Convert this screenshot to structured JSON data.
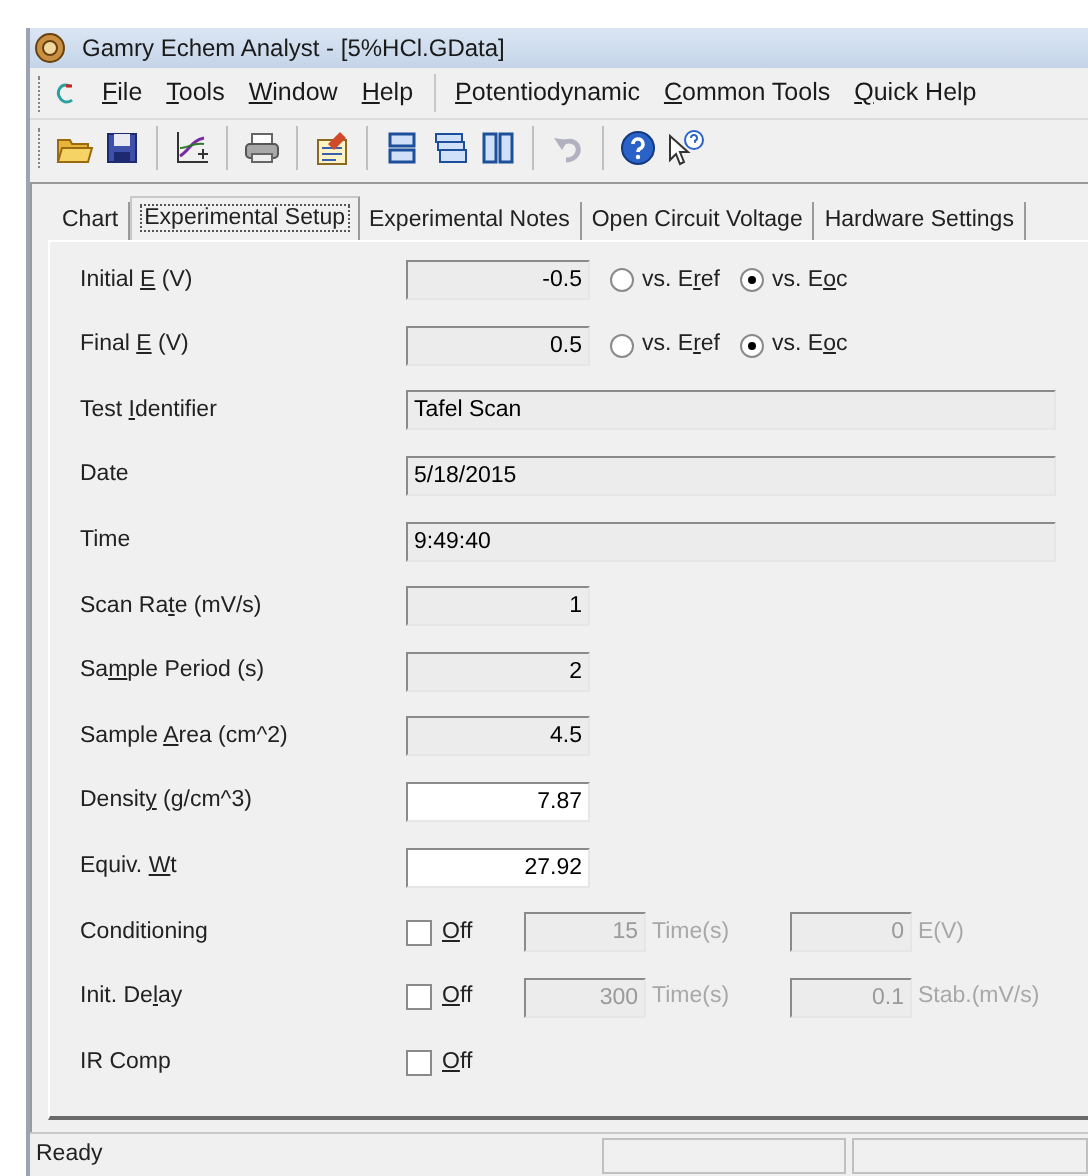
{
  "window": {
    "title": "Gamry Echem Analyst - [5%HCl.GData]"
  },
  "menu_groups": [
    [
      {
        "label": {
          "key": "F",
          "after": "ile"
        }
      },
      {
        "label": {
          "key": "T",
          "after": "ools"
        }
      },
      {
        "label": {
          "key": "W",
          "after": "indow"
        }
      },
      {
        "label": {
          "key": "H",
          "after": "elp"
        }
      }
    ],
    [
      {
        "label": {
          "key": "P",
          "after": "otentiodynamic"
        }
      },
      {
        "label": {
          "key": "C",
          "after": "ommon Tools"
        }
      },
      {
        "label": {
          "key": "Q",
          "after": "uick Help"
        }
      }
    ]
  ],
  "toolbar": [
    {
      "kind": "open",
      "disabled": false
    },
    {
      "kind": "save",
      "disabled": false
    },
    {
      "kind": "separator"
    },
    {
      "kind": "chart",
      "disabled": false
    },
    {
      "kind": "separator"
    },
    {
      "kind": "print",
      "disabled": false
    },
    {
      "kind": "separator"
    },
    {
      "kind": "notes",
      "disabled": false
    },
    {
      "kind": "separator"
    },
    {
      "kind": "rows",
      "disabled": false
    },
    {
      "kind": "stack",
      "disabled": false
    },
    {
      "kind": "columns",
      "disabled": false
    },
    {
      "kind": "separator"
    },
    {
      "kind": "undo",
      "disabled": true
    },
    {
      "kind": "separator"
    },
    {
      "kind": "help",
      "disabled": false
    },
    {
      "kind": "pointer_help",
      "disabled": false
    }
  ],
  "tabs": [
    {
      "label": "Chart",
      "selected": false
    },
    {
      "label": "Experimental Setup",
      "selected": true
    },
    {
      "label": "Experimental Notes",
      "selected": false
    },
    {
      "label": "Open Circuit Voltage",
      "selected": false
    },
    {
      "label": "Hardware Settings",
      "selected": false
    }
  ],
  "rows": [
    {
      "kind": "potential",
      "label": {
        "before": "Initial ",
        "key": "E",
        "after": " (V)"
      },
      "value": "-0.5",
      "editable": false,
      "options": [
        {
          "label": {
            "before": "vs. E",
            "key": "r",
            "after": "ef"
          },
          "selected": false
        },
        {
          "label": {
            "before": "vs. E",
            "key": "o",
            "after": "c"
          },
          "selected": true
        }
      ]
    },
    {
      "kind": "potential",
      "label": {
        "before": "Final ",
        "key": "E",
        "after": " (V)"
      },
      "value": "0.5",
      "editable": false,
      "options": [
        {
          "label": {
            "before": "vs. E",
            "key": "r",
            "after": "ef"
          },
          "selected": false
        },
        {
          "label": {
            "before": "vs. E",
            "key": "o",
            "after": "c"
          },
          "selected": true
        }
      ]
    },
    {
      "kind": "text",
      "label": {
        "before": "Test ",
        "key": "I",
        "after": "dentifier"
      },
      "value": "Tafel Scan",
      "editable": false
    },
    {
      "kind": "text",
      "label": {
        "before": "Date"
      },
      "value": "5/18/2015",
      "editable": false
    },
    {
      "kind": "text",
      "label": {
        "before": "Time"
      },
      "value": "9:49:40",
      "editable": false
    },
    {
      "kind": "number",
      "label": {
        "before": "Scan Ra",
        "key": "t",
        "after": "e (mV/s)"
      },
      "value": "1",
      "editable": false
    },
    {
      "kind": "number",
      "label": {
        "before": "Sa",
        "key": "m",
        "after": "ple Period (s)"
      },
      "value": "2",
      "editable": false
    },
    {
      "kind": "number",
      "label": {
        "before": "Sample ",
        "key": "A",
        "after": "rea (cm^2)"
      },
      "value": "4.5",
      "editable": false
    },
    {
      "kind": "number",
      "label": {
        "before": "Densit",
        "key": "y",
        "after": " (g/cm^3)"
      },
      "value": "7.87",
      "editable": true
    },
    {
      "kind": "number",
      "label": {
        "before": "Equiv. ",
        "key": "W",
        "after": "t"
      },
      "value": "27.92",
      "editable": true
    },
    {
      "kind": "option",
      "label": {
        "before": "Conditioning"
      },
      "check": {
        "label": {
          "key": "O",
          "after": "ff"
        },
        "checked": false
      },
      "params": [
        {
          "value": "15",
          "unit": "Time(s)"
        },
        {
          "value": "0",
          "unit": "E(V)"
        }
      ]
    },
    {
      "kind": "option",
      "label": {
        "before": "Init. De",
        "key": "l",
        "after": "ay"
      },
      "check": {
        "label": {
          "key": "O",
          "after": "ff"
        },
        "checked": false
      },
      "params": [
        {
          "value": "300",
          "unit": "Time(s)"
        },
        {
          "value": "0.1",
          "unit": "Stab.(mV/s)"
        }
      ]
    },
    {
      "kind": "option",
      "label": {
        "before": "IR Comp"
      },
      "check": {
        "label": {
          "key": "O",
          "after": "ff"
        },
        "checked": false
      }
    }
  ],
  "status_bar": {
    "text": "Ready"
  }
}
